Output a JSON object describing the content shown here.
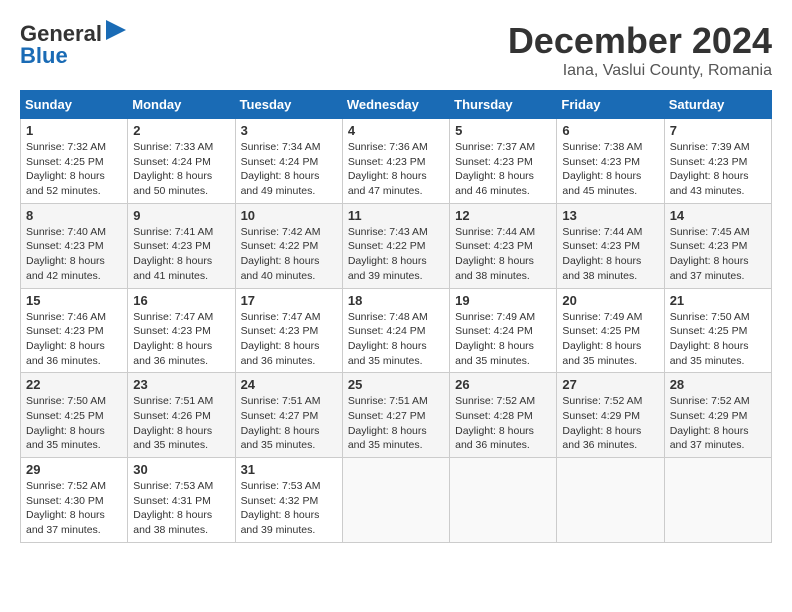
{
  "header": {
    "logo_general": "General",
    "logo_blue": "Blue",
    "title": "December 2024",
    "subtitle": "Iana, Vaslui County, Romania"
  },
  "calendar": {
    "days_of_week": [
      "Sunday",
      "Monday",
      "Tuesday",
      "Wednesday",
      "Thursday",
      "Friday",
      "Saturday"
    ],
    "weeks": [
      [
        {
          "day": "1",
          "sunrise": "Sunrise: 7:32 AM",
          "sunset": "Sunset: 4:25 PM",
          "daylight": "Daylight: 8 hours and 52 minutes."
        },
        {
          "day": "2",
          "sunrise": "Sunrise: 7:33 AM",
          "sunset": "Sunset: 4:24 PM",
          "daylight": "Daylight: 8 hours and 50 minutes."
        },
        {
          "day": "3",
          "sunrise": "Sunrise: 7:34 AM",
          "sunset": "Sunset: 4:24 PM",
          "daylight": "Daylight: 8 hours and 49 minutes."
        },
        {
          "day": "4",
          "sunrise": "Sunrise: 7:36 AM",
          "sunset": "Sunset: 4:23 PM",
          "daylight": "Daylight: 8 hours and 47 minutes."
        },
        {
          "day": "5",
          "sunrise": "Sunrise: 7:37 AM",
          "sunset": "Sunset: 4:23 PM",
          "daylight": "Daylight: 8 hours and 46 minutes."
        },
        {
          "day": "6",
          "sunrise": "Sunrise: 7:38 AM",
          "sunset": "Sunset: 4:23 PM",
          "daylight": "Daylight: 8 hours and 45 minutes."
        },
        {
          "day": "7",
          "sunrise": "Sunrise: 7:39 AM",
          "sunset": "Sunset: 4:23 PM",
          "daylight": "Daylight: 8 hours and 43 minutes."
        }
      ],
      [
        {
          "day": "8",
          "sunrise": "Sunrise: 7:40 AM",
          "sunset": "Sunset: 4:23 PM",
          "daylight": "Daylight: 8 hours and 42 minutes."
        },
        {
          "day": "9",
          "sunrise": "Sunrise: 7:41 AM",
          "sunset": "Sunset: 4:23 PM",
          "daylight": "Daylight: 8 hours and 41 minutes."
        },
        {
          "day": "10",
          "sunrise": "Sunrise: 7:42 AM",
          "sunset": "Sunset: 4:22 PM",
          "daylight": "Daylight: 8 hours and 40 minutes."
        },
        {
          "day": "11",
          "sunrise": "Sunrise: 7:43 AM",
          "sunset": "Sunset: 4:22 PM",
          "daylight": "Daylight: 8 hours and 39 minutes."
        },
        {
          "day": "12",
          "sunrise": "Sunrise: 7:44 AM",
          "sunset": "Sunset: 4:23 PM",
          "daylight": "Daylight: 8 hours and 38 minutes."
        },
        {
          "day": "13",
          "sunrise": "Sunrise: 7:44 AM",
          "sunset": "Sunset: 4:23 PM",
          "daylight": "Daylight: 8 hours and 38 minutes."
        },
        {
          "day": "14",
          "sunrise": "Sunrise: 7:45 AM",
          "sunset": "Sunset: 4:23 PM",
          "daylight": "Daylight: 8 hours and 37 minutes."
        }
      ],
      [
        {
          "day": "15",
          "sunrise": "Sunrise: 7:46 AM",
          "sunset": "Sunset: 4:23 PM",
          "daylight": "Daylight: 8 hours and 36 minutes."
        },
        {
          "day": "16",
          "sunrise": "Sunrise: 7:47 AM",
          "sunset": "Sunset: 4:23 PM",
          "daylight": "Daylight: 8 hours and 36 minutes."
        },
        {
          "day": "17",
          "sunrise": "Sunrise: 7:47 AM",
          "sunset": "Sunset: 4:23 PM",
          "daylight": "Daylight: 8 hours and 36 minutes."
        },
        {
          "day": "18",
          "sunrise": "Sunrise: 7:48 AM",
          "sunset": "Sunset: 4:24 PM",
          "daylight": "Daylight: 8 hours and 35 minutes."
        },
        {
          "day": "19",
          "sunrise": "Sunrise: 7:49 AM",
          "sunset": "Sunset: 4:24 PM",
          "daylight": "Daylight: 8 hours and 35 minutes."
        },
        {
          "day": "20",
          "sunrise": "Sunrise: 7:49 AM",
          "sunset": "Sunset: 4:25 PM",
          "daylight": "Daylight: 8 hours and 35 minutes."
        },
        {
          "day": "21",
          "sunrise": "Sunrise: 7:50 AM",
          "sunset": "Sunset: 4:25 PM",
          "daylight": "Daylight: 8 hours and 35 minutes."
        }
      ],
      [
        {
          "day": "22",
          "sunrise": "Sunrise: 7:50 AM",
          "sunset": "Sunset: 4:25 PM",
          "daylight": "Daylight: 8 hours and 35 minutes."
        },
        {
          "day": "23",
          "sunrise": "Sunrise: 7:51 AM",
          "sunset": "Sunset: 4:26 PM",
          "daylight": "Daylight: 8 hours and 35 minutes."
        },
        {
          "day": "24",
          "sunrise": "Sunrise: 7:51 AM",
          "sunset": "Sunset: 4:27 PM",
          "daylight": "Daylight: 8 hours and 35 minutes."
        },
        {
          "day": "25",
          "sunrise": "Sunrise: 7:51 AM",
          "sunset": "Sunset: 4:27 PM",
          "daylight": "Daylight: 8 hours and 35 minutes."
        },
        {
          "day": "26",
          "sunrise": "Sunrise: 7:52 AM",
          "sunset": "Sunset: 4:28 PM",
          "daylight": "Daylight: 8 hours and 36 minutes."
        },
        {
          "day": "27",
          "sunrise": "Sunrise: 7:52 AM",
          "sunset": "Sunset: 4:29 PM",
          "daylight": "Daylight: 8 hours and 36 minutes."
        },
        {
          "day": "28",
          "sunrise": "Sunrise: 7:52 AM",
          "sunset": "Sunset: 4:29 PM",
          "daylight": "Daylight: 8 hours and 37 minutes."
        }
      ],
      [
        {
          "day": "29",
          "sunrise": "Sunrise: 7:52 AM",
          "sunset": "Sunset: 4:30 PM",
          "daylight": "Daylight: 8 hours and 37 minutes."
        },
        {
          "day": "30",
          "sunrise": "Sunrise: 7:53 AM",
          "sunset": "Sunset: 4:31 PM",
          "daylight": "Daylight: 8 hours and 38 minutes."
        },
        {
          "day": "31",
          "sunrise": "Sunrise: 7:53 AM",
          "sunset": "Sunset: 4:32 PM",
          "daylight": "Daylight: 8 hours and 39 minutes."
        },
        null,
        null,
        null,
        null
      ]
    ]
  }
}
